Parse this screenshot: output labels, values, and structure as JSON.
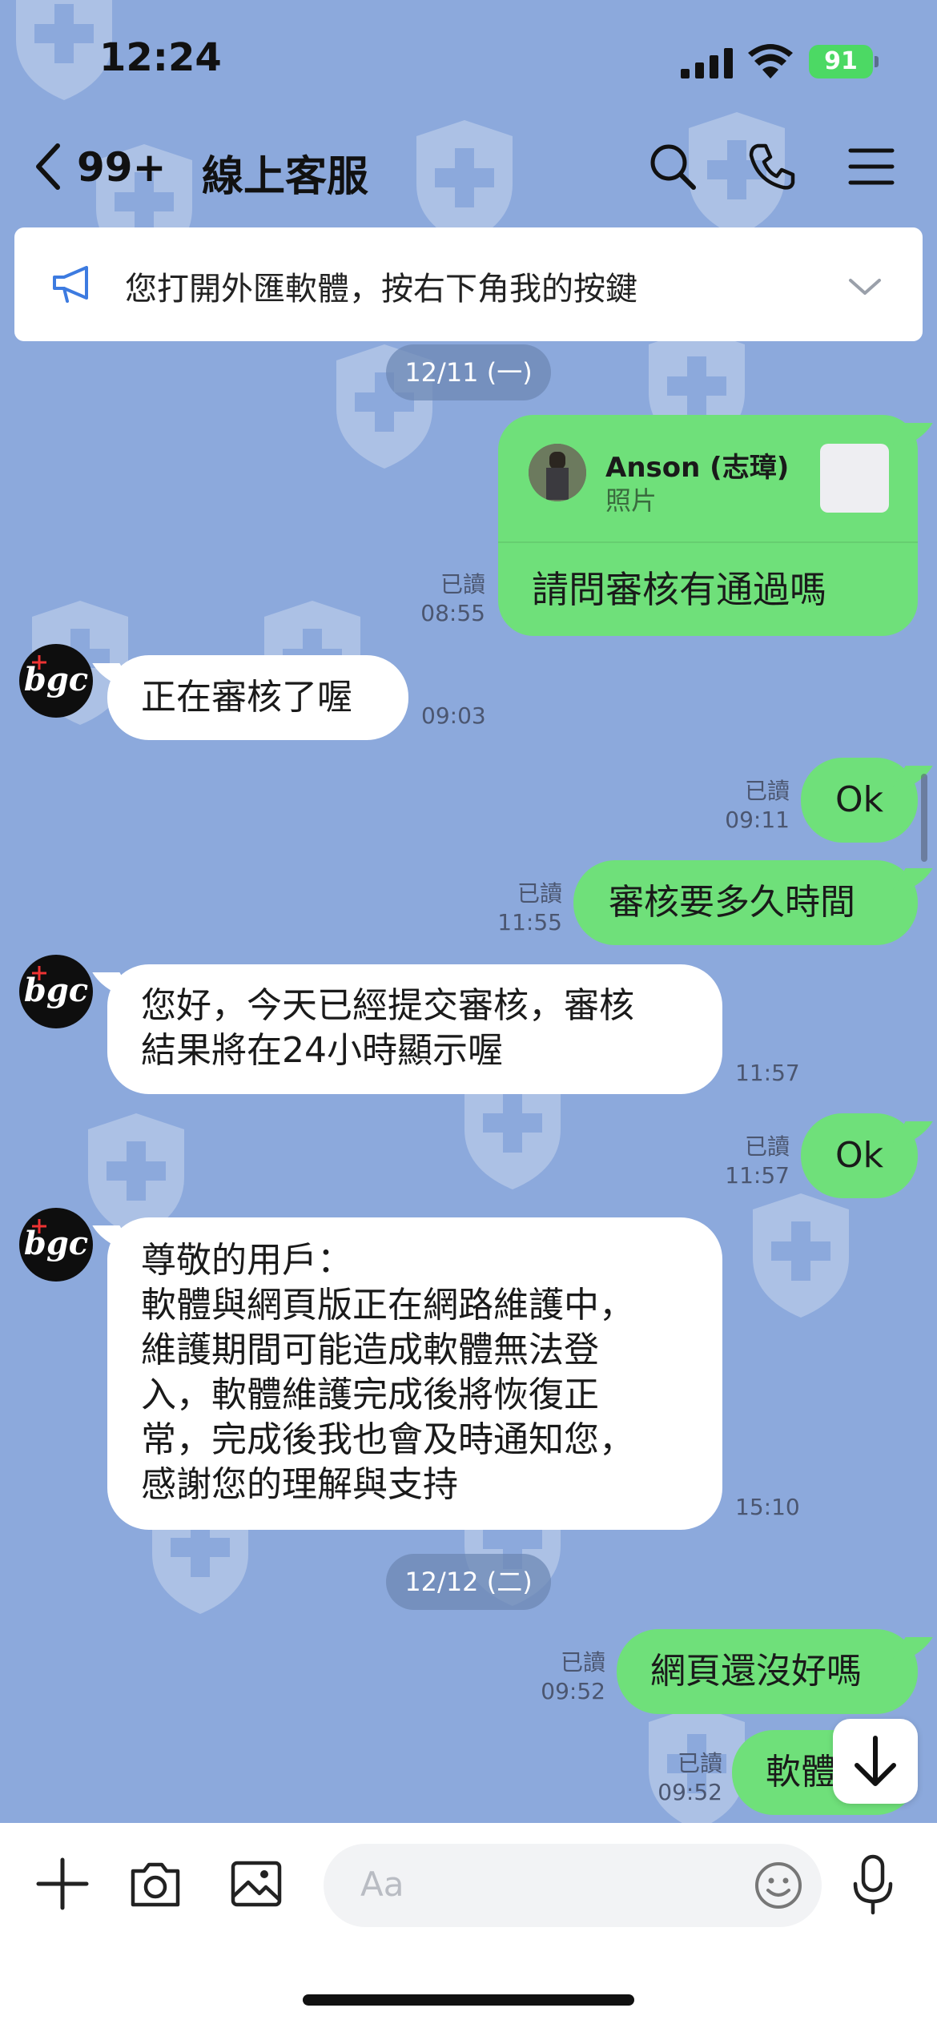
{
  "status_bar": {
    "time": "12:24",
    "battery": "91"
  },
  "header": {
    "unread_count": "99+",
    "title": "線上客服"
  },
  "announcement": {
    "text": "您打開外匯軟體，按右下角我的按鍵"
  },
  "dates": {
    "day1": "12/11 (一)",
    "day2": "12/12 (二)"
  },
  "reply_card": {
    "name": "Anson (志璋)",
    "subtitle": "照片",
    "message": "請問審核有通過嗎",
    "read": "已讀",
    "time": "08:55"
  },
  "messages": [
    {
      "side": "in",
      "avatar": "bgc",
      "text": "正在審核了喔",
      "time": "09:03"
    },
    {
      "side": "out",
      "text": "Ok",
      "read": "已讀",
      "time": "09:11"
    },
    {
      "side": "out",
      "text": "審核要多久時間",
      "read": "已讀",
      "time": "11:55"
    },
    {
      "side": "in",
      "avatar": "bgc",
      "lines": [
        "您好，今天已經提交審核，審核",
        "結果將在24小時顯示喔"
      ],
      "time": "11:57"
    },
    {
      "side": "out",
      "text": "Ok",
      "read": "已讀",
      "time": "11:57"
    },
    {
      "side": "in",
      "avatar": "bgc",
      "lines": [
        "尊敬的用戶：",
        "軟體與網頁版正在網路維護中，",
        "維護期間可能造成軟體無法登",
        "入，軟體維護完成後將恢復正",
        "常，完成後我也會及時通知您，",
        "感謝您的理解與支持"
      ],
      "time": "15:10"
    },
    {
      "side": "out",
      "text": "網頁還沒好嗎",
      "read": "已讀",
      "time": "09:52"
    },
    {
      "side": "out",
      "text": "軟體",
      "read": "已讀",
      "time": "09:52"
    }
  ],
  "composer": {
    "placeholder": "Aa"
  },
  "icons": [
    "back-icon",
    "search-icon",
    "phone-icon",
    "menu-icon",
    "megaphone-icon",
    "chevron-down-icon",
    "plus-icon",
    "camera-icon",
    "image-icon",
    "emoji-icon",
    "microphone-icon",
    "arrow-down-icon"
  ],
  "colors": {
    "background": "#8ca9dc",
    "outgoing_bubble": "#6fe07a",
    "incoming_bubble": "#ffffff"
  }
}
